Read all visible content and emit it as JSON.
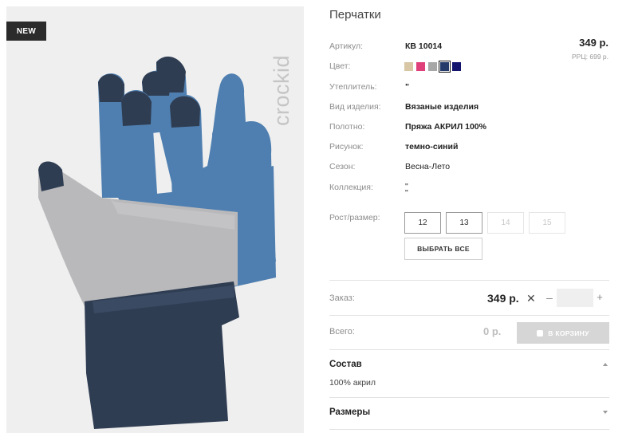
{
  "product": {
    "title": "Перчатки",
    "badge": "NEW",
    "brand": "crockid"
  },
  "specs": [
    {
      "label": "Артикул:",
      "value": "КВ 10014"
    },
    {
      "label": "Цвет:",
      "value": ""
    },
    {
      "label": "Утеплитель:",
      "value": "\""
    },
    {
      "label": "Вид изделия:",
      "value": "Вязаные изделия"
    },
    {
      "label": "Полотно:",
      "value": "Пряжа АКРИЛ 100%"
    },
    {
      "label": "Рисунок:",
      "value": "темно-синий"
    },
    {
      "label": "Сезон:",
      "value": "Весна-Лето"
    },
    {
      "label": "Коллекция:",
      "value": "\"",
      "value2": "\""
    }
  ],
  "price": {
    "current": "349 р.",
    "rrp": "РРЦ: 699 р."
  },
  "colors": [
    {
      "hex": "#d8c6a4",
      "selected": false
    },
    {
      "hex": "#e0407a",
      "selected": false
    },
    {
      "hex": "#a7a7a7",
      "selected": false
    },
    {
      "hex": "#233a6b",
      "selected": true
    },
    {
      "hex": "#12146e",
      "selected": false
    }
  ],
  "size_section": {
    "label": "Рост/размер:",
    "sizes": [
      {
        "label": "12",
        "available": true
      },
      {
        "label": "13",
        "available": true
      },
      {
        "label": "14",
        "available": false
      },
      {
        "label": "15",
        "available": false
      }
    ],
    "select_all": "ВЫБРАТЬ ВСЕ"
  },
  "order": {
    "label": "Заказ:",
    "price": "349 р.",
    "times": "✕",
    "minus": "–",
    "plus": "+",
    "quantity": ""
  },
  "total": {
    "label": "Всего:",
    "value": "0 р.",
    "cart_button": "В КОРЗИНУ"
  },
  "accordion": {
    "composition": {
      "title": "Состав",
      "body": "100% акрил",
      "expanded": true
    },
    "sizes": {
      "title": "Размеры",
      "expanded": false
    }
  }
}
